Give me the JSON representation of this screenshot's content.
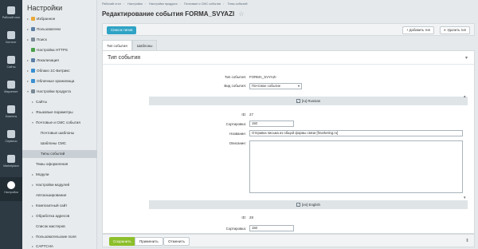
{
  "rail": {
    "items": [
      {
        "label": "Рабочий стол",
        "icon": "desktop-icon"
      },
      {
        "label": "Контент",
        "icon": "content-icon"
      },
      {
        "label": "Сайты",
        "icon": "sites-icon"
      },
      {
        "label": "Маркетинг",
        "icon": "marketing-icon"
      },
      {
        "label": "Клиенты",
        "icon": "clients-icon"
      },
      {
        "label": "Сервисы",
        "icon": "services-icon"
      },
      {
        "label": "Marketplace",
        "icon": "marketplace-icon"
      },
      {
        "label": "Настройки",
        "icon": "gear-icon"
      }
    ]
  },
  "menu": {
    "title": "Настройки",
    "items": [
      {
        "label": "Избранное",
        "arrow": "▸",
        "color": "#e8a93a"
      },
      {
        "label": "Пользователи",
        "arrow": "▸",
        "color": "#5b7fa6"
      },
      {
        "label": "Поиск",
        "arrow": "▸",
        "color": "#7a8a96"
      },
      {
        "label": "Настройка HTTPS",
        "arrow": "",
        "color": "#4aa04a"
      },
      {
        "label": "Локализация",
        "arrow": "▸",
        "color": "#5b7fa6"
      },
      {
        "label": "Облако 1С-Битрикс",
        "arrow": "▸",
        "color": "#3a8fd0"
      },
      {
        "label": "Облачные хранилища",
        "arrow": "▸",
        "color": "#3a8fd0"
      },
      {
        "label": "Настройки продукта",
        "arrow": "▾",
        "color": "#7a8a96"
      },
      {
        "label": "Сайты",
        "arrow": "▸",
        "color": ""
      },
      {
        "label": "Языковые параметры",
        "arrow": "▸",
        "color": ""
      },
      {
        "label": "Почтовые и СМС события",
        "arrow": "▾",
        "color": ""
      },
      {
        "label": "Почтовые шаблоны",
        "arrow": "",
        "color": ""
      },
      {
        "label": "Шаблоны СМС",
        "arrow": "",
        "color": ""
      },
      {
        "label": "Типы событий",
        "arrow": "",
        "color": ""
      },
      {
        "label": "Темы оформления",
        "arrow": "",
        "color": ""
      },
      {
        "label": "Модули",
        "arrow": "▸",
        "color": ""
      },
      {
        "label": "Настройки модулей",
        "arrow": "▸",
        "color": ""
      },
      {
        "label": "Автокэширование",
        "arrow": "",
        "color": ""
      },
      {
        "label": "Композитный сайт",
        "arrow": "▸",
        "color": ""
      },
      {
        "label": "Обработка адресов",
        "arrow": "▸",
        "color": ""
      },
      {
        "label": "Список мастеров",
        "arrow": "",
        "color": ""
      },
      {
        "label": "Пользовательские поля",
        "arrow": "▸",
        "color": ""
      },
      {
        "label": "CAPTCHA",
        "arrow": "▸",
        "color": ""
      }
    ]
  },
  "breadcrumbs": [
    "Рабочий стол",
    "Настройки",
    "Настройки продукта",
    "Почтовые и СМС события",
    "Типы событий"
  ],
  "page": {
    "title": "Редактирование события FORMA_SVYAZI",
    "star": "☆"
  },
  "toolbar": {
    "list_label": "Список типов",
    "add_label": "+ Добавить тип",
    "delete_label": "✕ Удалить тип"
  },
  "tabs": [
    {
      "label": "Тип события"
    },
    {
      "label": "Шаблоны"
    }
  ],
  "form": {
    "section_title": "Тип события",
    "event_type_label": "Тип события:",
    "event_type_value": "FORMA_SVYAZI",
    "kind_label": "Вид события:",
    "kind_value": "Почтовое событие",
    "ru": {
      "bar_label": "[ru] Russian",
      "id_label": "ID:",
      "id_value": "27",
      "sort_label": "Сортировка:",
      "sort_value": "150",
      "name_label": "Название:",
      "name_value": "Отправка письма из общей формы связи [fmarketing.ru]",
      "desc_label": "Описание:"
    },
    "en": {
      "bar_label": "[en] English",
      "id_label": "ID:",
      "id_value": "28",
      "sort_label": "Сортировка:",
      "sort_value": "150"
    }
  },
  "actions": {
    "save_label": "Сохранить",
    "apply_label": "Применить",
    "cancel_label": "Отменить"
  },
  "colors": {
    "accent_blue": "#2ea3c5",
    "save_green": "#8cbf2a",
    "rail_dark": "#2d3a44"
  }
}
